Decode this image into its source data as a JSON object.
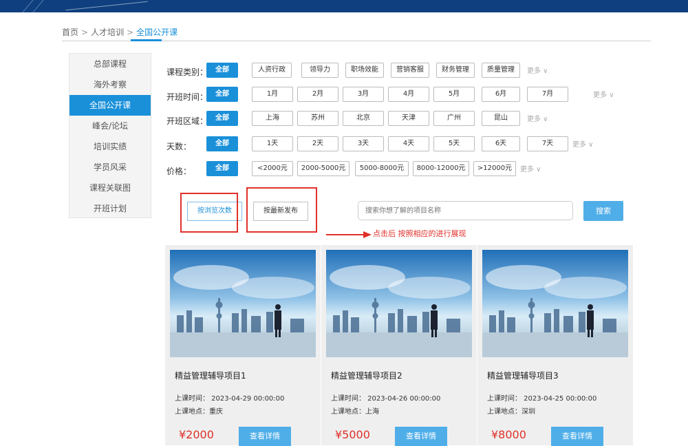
{
  "breadcrumb": {
    "home": "首页",
    "sep1": ">",
    "level2": "人才培训",
    "sep2": ">",
    "current": "全国公开课"
  },
  "sidebar": {
    "items": [
      {
        "label": "总部课程",
        "active": false
      },
      {
        "label": "海外考察",
        "active": false
      },
      {
        "label": "全国公开课",
        "active": true
      },
      {
        "label": "峰会/论坛",
        "active": false
      },
      {
        "label": "培训实绩",
        "active": false
      },
      {
        "label": "学员风采",
        "active": false
      },
      {
        "label": "课程关联图",
        "active": false
      },
      {
        "label": "开班计划",
        "active": false
      }
    ]
  },
  "filters": {
    "category": {
      "label": "课程类别：",
      "options": [
        "全部",
        "人资行政",
        "领导力",
        "职场效能",
        "营销客服",
        "财务管理",
        "质量管理"
      ],
      "more": "更多 ∨"
    },
    "time": {
      "label": "开班时间：",
      "options": [
        "全部",
        "1月",
        "2月",
        "3月",
        "4月",
        "5月",
        "6月",
        "7月"
      ],
      "more": "更多 ∨"
    },
    "region": {
      "label": "开班区域：",
      "options": [
        "全部",
        "上海",
        "苏州",
        "北京",
        "天津",
        "广州",
        "昆山"
      ],
      "more": "更多 ∨"
    },
    "days": {
      "label": "天数：",
      "options": [
        "全部",
        "1天",
        "2天",
        "3天",
        "4天",
        "5天",
        "6天",
        "7天"
      ],
      "more": "更多 ∨"
    },
    "price": {
      "label": "价格：",
      "options": [
        "全部",
        "<2000元",
        "2000-5000元",
        "5000-8000元",
        "8000-12000元",
        ">12000元"
      ],
      "more": "更多 ∨"
    }
  },
  "sort": {
    "by_views": "按浏览次数",
    "by_newest": "按最新发布"
  },
  "search": {
    "placeholder": "搜索你想了解的项目名称",
    "button": "搜索"
  },
  "annotation": "点击后 按照相应的进行展现",
  "colors": {
    "accent": "#1a90d9",
    "button": "#4faee8",
    "price": "#e0302a",
    "annotation": "#e0302a"
  },
  "cards": [
    {
      "title": "精益管理辅导项目1",
      "time": "上课时间： 2023-04-29 00:00:00",
      "place": "上课地点：重庆",
      "price": "¥2000",
      "detail": "查看详情"
    },
    {
      "title": "精益管理辅导项目2",
      "time": "上课时间： 2023-04-26 00:00:00",
      "place": "上课地点：上海",
      "price": "¥5000",
      "detail": "查看详情"
    },
    {
      "title": "精益管理辅导项目3",
      "time": "上课时间： 2023-04-25 00:00:00",
      "place": "上课地点：深圳",
      "price": "¥8000",
      "detail": "查看详情"
    }
  ]
}
